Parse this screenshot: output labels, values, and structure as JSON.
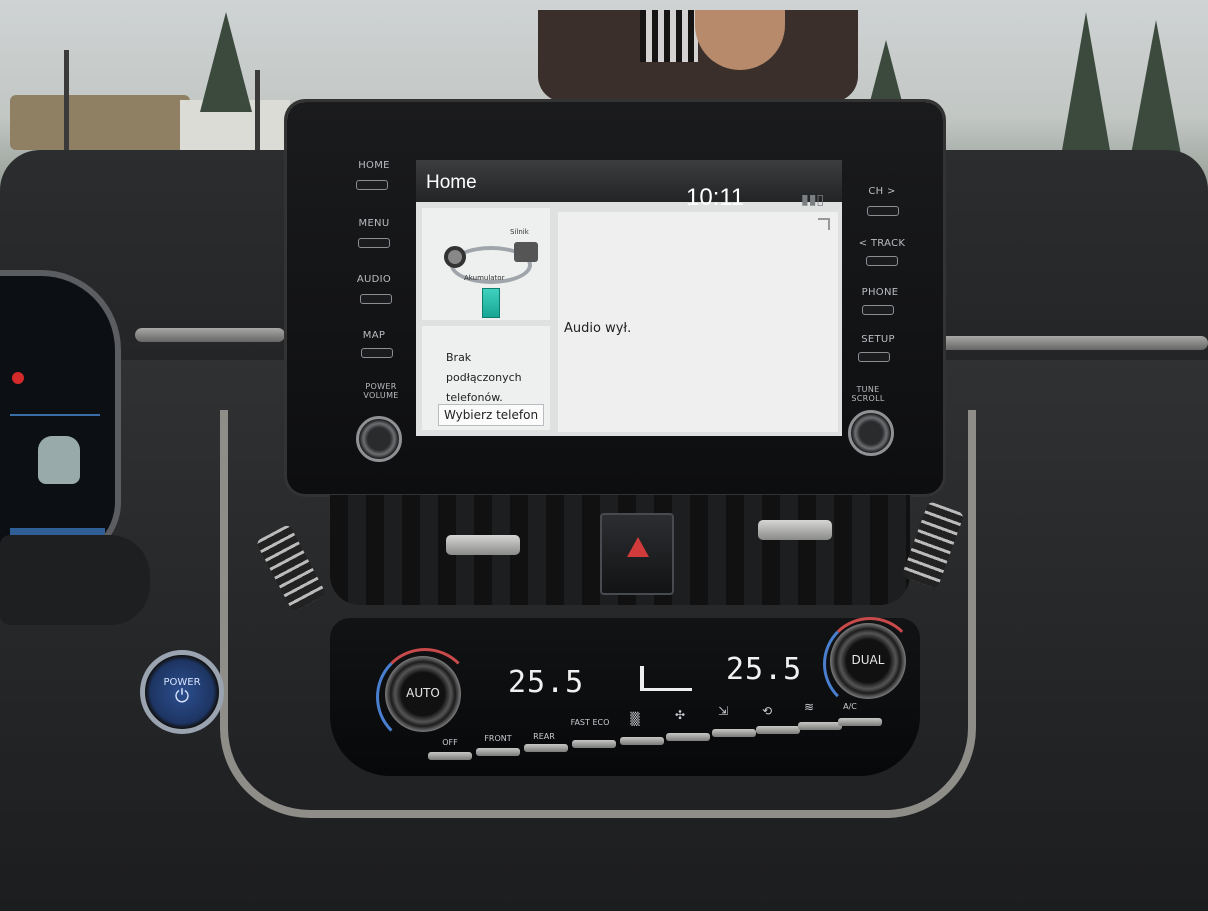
{
  "head_unit": {
    "left_buttons": [
      "HOME",
      "MENU",
      "AUDIO",
      "MAP"
    ],
    "left_knob_label": "POWER VOLUME",
    "right_buttons": [
      "CH >",
      "< TRACK",
      "PHONE",
      "SETUP"
    ],
    "right_knob_label": "TUNE SCROLL"
  },
  "screen": {
    "title": "Home",
    "time": "10:11",
    "signal_icon": "signal-strength-icon",
    "energy": {
      "engine_label": "Silnik",
      "battery_label": "Akumulator"
    },
    "phone": {
      "message": "Brak podłączonych telefonów.",
      "button": "Wybierz telefon"
    },
    "audio": {
      "status": "Audio wył."
    }
  },
  "climate": {
    "left_knob": "AUTO",
    "right_knob": "DUAL",
    "left_temp": "25.5",
    "right_temp": "25.5",
    "buttons": [
      "OFF",
      "FRONT",
      "REAR",
      "FAST ECO",
      "A/C"
    ]
  },
  "power_button": {
    "label": "POWER"
  },
  "colors": {
    "battery": "#2fc7b3",
    "hazard": "#d23b3b",
    "power": "#1d3563",
    "heat": "#c84a4a",
    "cool": "#4a7fd0"
  }
}
